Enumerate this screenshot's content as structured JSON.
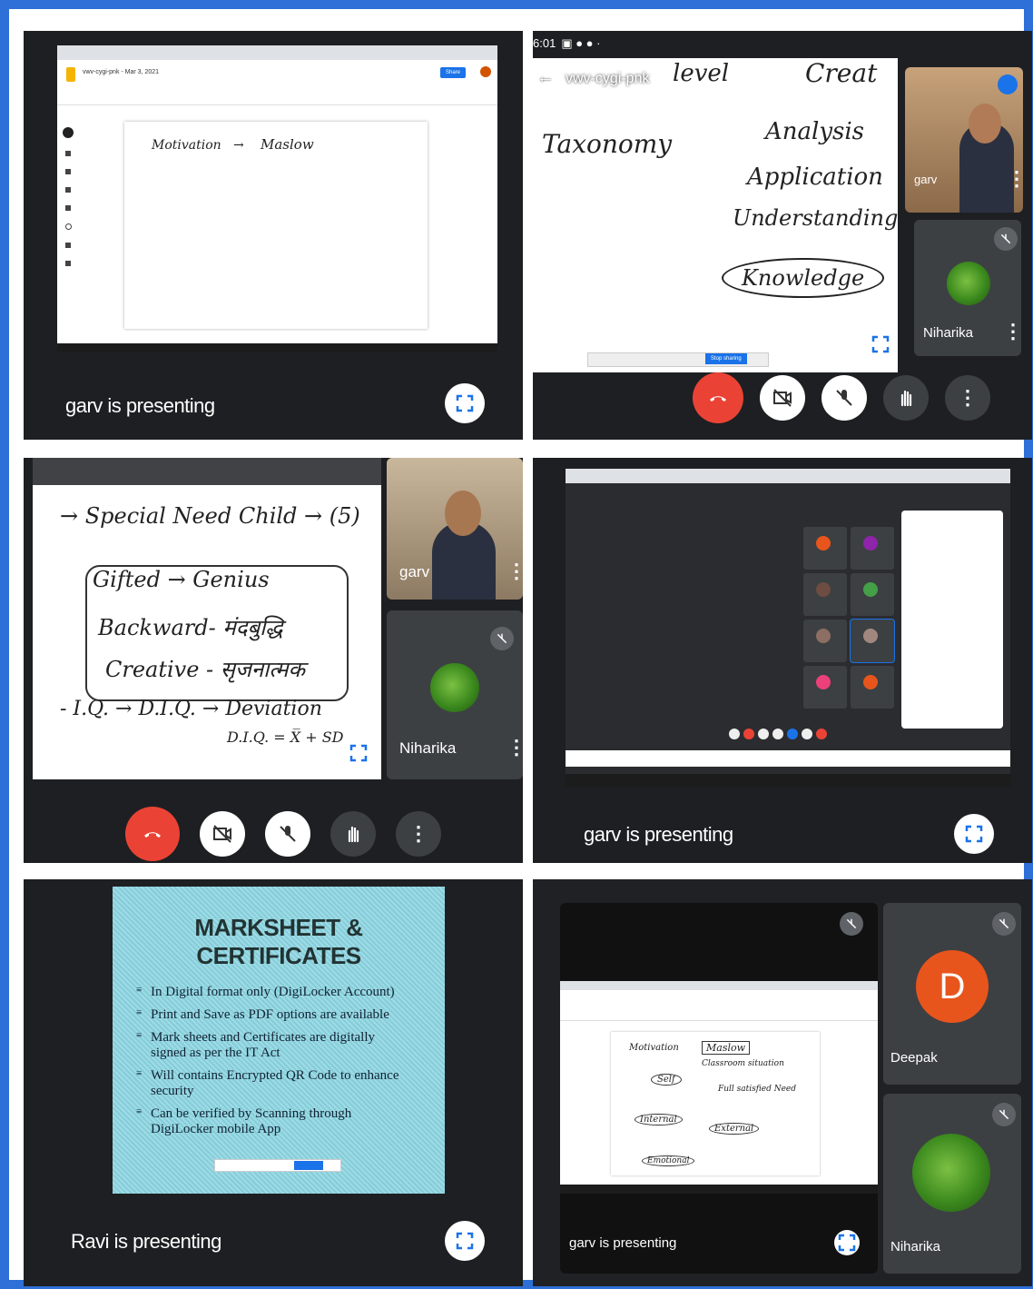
{
  "tiles": {
    "t1": {
      "presenting": "garv is presenting",
      "tab_title": "vwv-cygi-pnk - Mar 3, 2021",
      "whiteboard_text": [
        "Motivation",
        "→",
        "Maslow"
      ],
      "share_btn": "Share"
    },
    "t2": {
      "status_time": "6:01",
      "url": "vwv-cygi-pnk",
      "whiteboard_text": [
        "Taxonomy",
        "level",
        "Creat",
        "Analysis",
        "Application",
        "Understanding",
        "Knowledge"
      ],
      "participants": [
        {
          "name": "garv"
        },
        {
          "name": "Niharika"
        }
      ],
      "stop_sharing": "Stop sharing"
    },
    "t3": {
      "whiteboard_text": [
        "→ Special Need Child → (5)",
        "Gifted → Genius",
        "Backward- मंदबुद्धि",
        "Creative - सृजनात्मक",
        "- I.Q. → D.I.Q. → Deviation",
        "D.I.Q. = X̅ + SD"
      ],
      "participants": [
        {
          "name": "garv"
        },
        {
          "name": "Niharika"
        }
      ]
    },
    "t4": {
      "presenting": "garv is presenting"
    },
    "t5": {
      "presenting": "Ravi is presenting",
      "slide_title": "MARKSHEET & CERTIFICATES",
      "bullets": [
        "In Digital format only (DigiLocker Account)",
        "Print and Save as PDF options are available",
        "Mark sheets and Certificates are digitally signed as per the IT Act",
        "Will contains Encrypted QR Code to enhance security",
        "Can be verified by Scanning through DigiLocker mobile App"
      ]
    },
    "t6": {
      "presenting": "garv is presenting",
      "participants": [
        {
          "name": "Deepak",
          "initial": "D"
        },
        {
          "name": "Niharika"
        }
      ],
      "whiteboard_text": [
        "Motivation",
        "Maslow",
        "Classroom situation",
        "Self",
        "Internal",
        "External",
        "Emotional",
        "Full satisfied Need"
      ]
    }
  },
  "colors": {
    "frame": "#2f6fd8",
    "end_call": "#ea4335",
    "tile_bg": "#1e1f22",
    "avatar": "#e8551c"
  }
}
